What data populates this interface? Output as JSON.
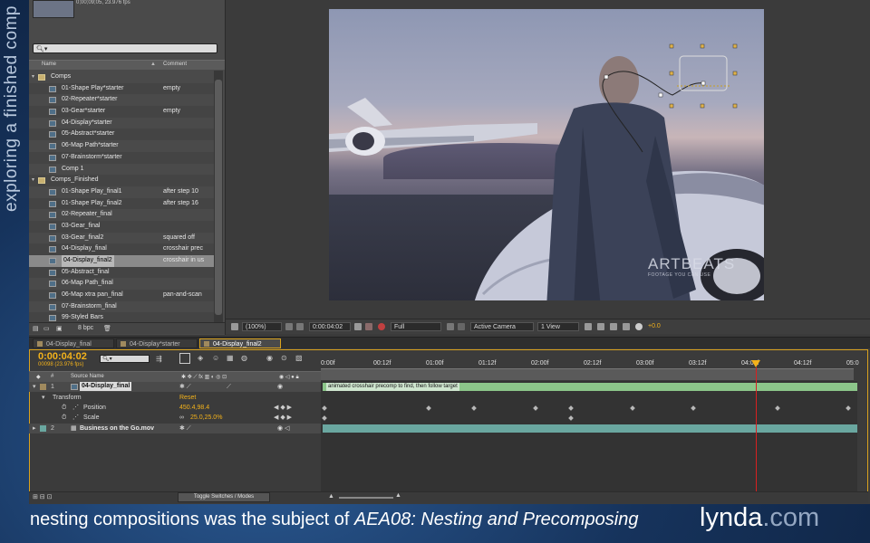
{
  "side_caption": "exploring a finished comp",
  "subtitle": {
    "prefix": "nesting compositions was the subject of ",
    "italic": "AEA08: Nesting and Precomposing"
  },
  "logo": {
    "word": "lynda",
    "tld": ".com"
  },
  "project": {
    "thumb_info": "0;00;09;05, 23.976 fps",
    "search_placeholder": "",
    "columns": {
      "name": "Name",
      "comment": "Comment"
    },
    "items": [
      {
        "type": "folder",
        "name": "Comps",
        "comment": "",
        "indent": 0
      },
      {
        "type": "comp",
        "name": "01-Shape Play*starter",
        "comment": "empty",
        "indent": 1
      },
      {
        "type": "comp",
        "name": "02-Repeater*starter",
        "comment": "",
        "indent": 1
      },
      {
        "type": "comp",
        "name": "03-Gear*starter",
        "comment": "empty",
        "indent": 1
      },
      {
        "type": "comp",
        "name": "04-Display*starter",
        "comment": "",
        "indent": 1
      },
      {
        "type": "comp",
        "name": "05-Abstract*starter",
        "comment": "",
        "indent": 1
      },
      {
        "type": "comp",
        "name": "06-Map Path*starter",
        "comment": "",
        "indent": 1
      },
      {
        "type": "comp",
        "name": "07-Brainstorm*starter",
        "comment": "",
        "indent": 1
      },
      {
        "type": "comp",
        "name": "Comp 1",
        "comment": "",
        "indent": 1
      },
      {
        "type": "folder",
        "name": "Comps_Finished",
        "comment": "",
        "indent": 0
      },
      {
        "type": "comp",
        "name": "01-Shape Play_final1",
        "comment": "after step 10",
        "indent": 1
      },
      {
        "type": "comp",
        "name": "01-Shape Play_final2",
        "comment": "after step 16",
        "indent": 1
      },
      {
        "type": "comp",
        "name": "02-Repeater_final",
        "comment": "",
        "indent": 1
      },
      {
        "type": "comp",
        "name": "03-Gear_final",
        "comment": "",
        "indent": 1
      },
      {
        "type": "comp",
        "name": "03-Gear_final2",
        "comment": "squared off",
        "indent": 1
      },
      {
        "type": "comp",
        "name": "04-Display_final",
        "comment": "crosshair prec",
        "indent": 1
      },
      {
        "type": "comp",
        "name": "04-Display_final2",
        "comment": "crosshair in us",
        "indent": 1,
        "selected": true
      },
      {
        "type": "comp",
        "name": "05-Abstract_final",
        "comment": "",
        "indent": 1
      },
      {
        "type": "comp",
        "name": "06-Map Path_final",
        "comment": "",
        "indent": 1
      },
      {
        "type": "comp",
        "name": "06-Map xtra pan_final",
        "comment": "pan-and-scan",
        "indent": 1
      },
      {
        "type": "comp",
        "name": "07-Brainstorm_final",
        "comment": "",
        "indent": 1
      },
      {
        "type": "comp",
        "name": "99-Styled Bars",
        "comment": "",
        "indent": 1
      }
    ],
    "bpc": "8 bpc"
  },
  "viewer": {
    "watermark": "ARTBEATS",
    "watermark_sub": "FOOTAGE YOU CAN USE",
    "zoom": "(100%)",
    "timecode": "0:00:04:02",
    "resolution": "Full",
    "camera": "Active Camera",
    "views": "1 View",
    "exposure": "+0.0"
  },
  "timeline": {
    "tabs": [
      {
        "label": "04-Display_final",
        "active": false
      },
      {
        "label": "04-Display*starter",
        "active": false
      },
      {
        "label": "04-Display_final2",
        "active": true
      }
    ],
    "timecode": "0:00:04:02",
    "frames": "00098 (23.976 fps)",
    "search": "",
    "col_num": "#",
    "col_source": "Source Name",
    "ruler": [
      "0:00f",
      "00:12f",
      "01:00f",
      "01:12f",
      "02:00f",
      "02:12f",
      "03:00f",
      "03:12f",
      "04:00f",
      "04:12f",
      "05:0"
    ],
    "layers": {
      "l1_num": "1",
      "l1_name": "04-Display_final",
      "transform": "Transform",
      "reset": "Reset",
      "position_label": "Position",
      "position_value": "450.4,98.4",
      "scale_label": "Scale",
      "scale_value": "25.0,25.0%",
      "l2_num": "2",
      "l2_name": "Business on the Go.mov"
    },
    "layer_comment": "animated crosshair precomp to find, then follow target",
    "toggle_label": "Toggle Switches / Modes"
  },
  "colors": {
    "accent": "#f3b21b",
    "layer1_bar": "#8cc68a",
    "layer2_bar": "#6aa7a0",
    "playhead": "#d82020"
  }
}
